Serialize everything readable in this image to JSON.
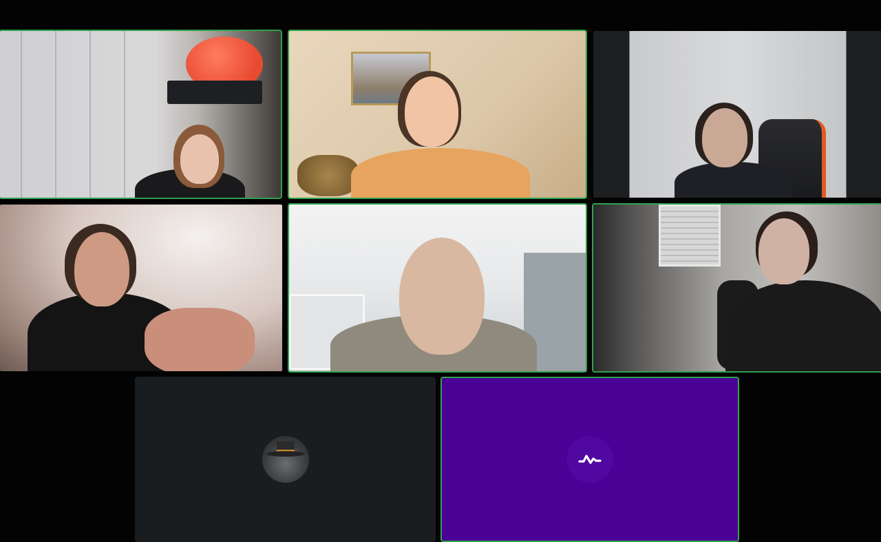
{
  "meeting": {
    "tiles": [
      {
        "id": "participant-1",
        "state": "speaking"
      },
      {
        "id": "participant-2",
        "state": "speaking"
      },
      {
        "id": "participant-3",
        "state": "quiet"
      },
      {
        "id": "participant-4",
        "state": "quiet"
      },
      {
        "id": "participant-5",
        "state": "speaking"
      },
      {
        "id": "participant-6",
        "state": "speaking"
      },
      {
        "id": "participant-7",
        "state": "quiet",
        "avatar_icon": "hat-portrait-avatar"
      },
      {
        "id": "participant-8",
        "state": "speaking",
        "avatar_icon": "waveform-icon"
      }
    ]
  },
  "colors": {
    "background": "#030303",
    "speaking_border": "#31a24c",
    "empty_tile": "#1a1d20",
    "bot_tile": "#4a0196"
  }
}
